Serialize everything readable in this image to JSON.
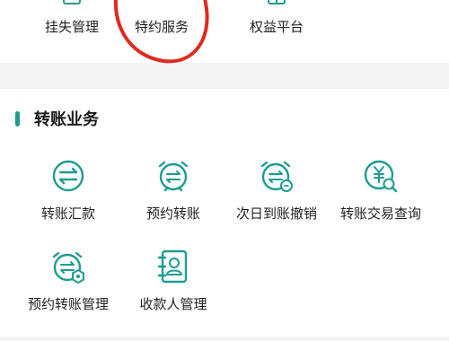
{
  "top_menu": {
    "items": [
      {
        "label": "挂失管理",
        "icon": "lock-icon"
      },
      {
        "label": "特约服务",
        "icon": "service-icon"
      },
      {
        "label": "权益平台",
        "icon": "gift-icon"
      }
    ],
    "highlight_color": "#e02a1f"
  },
  "transfer_section": {
    "title": "转账业务",
    "accent_color": "#1d9c91",
    "items": [
      {
        "label": "转账汇款",
        "icon": "transfer-arrows-icon"
      },
      {
        "label": "预约转账",
        "icon": "scheduled-transfer-icon"
      },
      {
        "label": "次日到账撤销",
        "icon": "next-day-cancel-icon"
      },
      {
        "label": "转账交易查询",
        "icon": "transfer-query-icon"
      },
      {
        "label": "预约转账管理",
        "icon": "scheduled-transfer-manage-icon"
      },
      {
        "label": "收款人管理",
        "icon": "payee-manage-icon"
      }
    ]
  }
}
